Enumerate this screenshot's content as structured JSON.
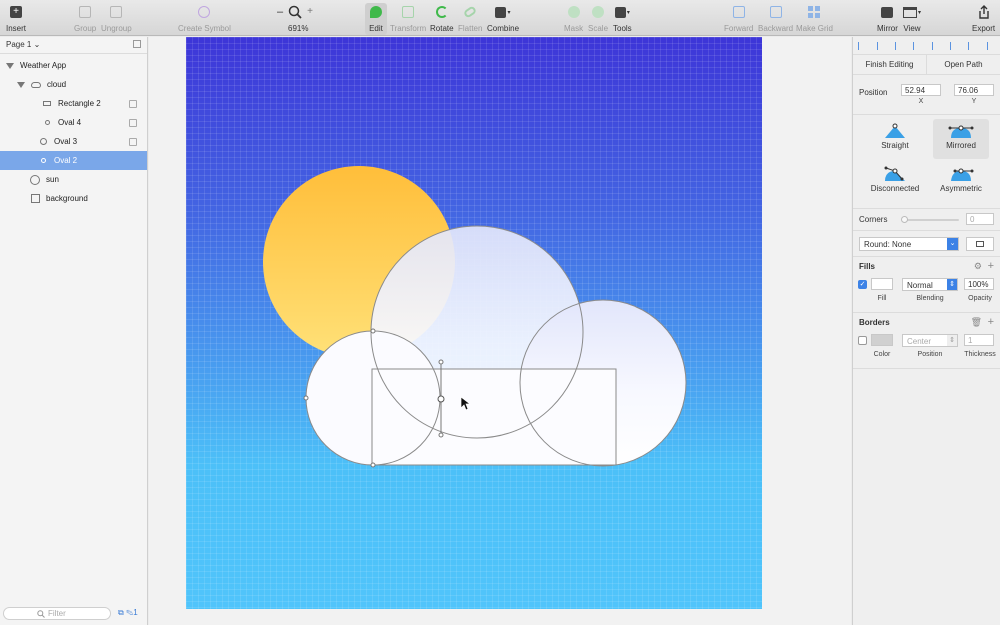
{
  "toolbar": {
    "insert": "Insert",
    "group": "Group",
    "ungroup": "Ungroup",
    "create_symbol": "Create Symbol",
    "zoom_minus": "–",
    "zoom_plus": "+",
    "zoom_level": "691%",
    "edit": "Edit",
    "transform": "Transform",
    "rotate": "Rotate",
    "flatten": "Flatten",
    "combine": "Combine",
    "mask": "Mask",
    "scale": "Scale",
    "tools": "Tools",
    "forward": "Forward",
    "backward": "Backward",
    "make_grid": "Make Grid",
    "mirror": "Mirror",
    "view": "View",
    "export": "Export"
  },
  "sidebar": {
    "page": "Page 1 ⌄",
    "layers": [
      {
        "label": "Weather App",
        "icon": "disclosure-triangle"
      },
      {
        "label": "cloud",
        "icon": "cloud-group-icon"
      },
      {
        "label": "Rectangle 2",
        "icon": "rectangle-icon"
      },
      {
        "label": "Oval 4",
        "icon": "oval-icon"
      },
      {
        "label": "Oval 3",
        "icon": "oval-icon"
      },
      {
        "label": "Oval 2",
        "icon": "oval-icon"
      },
      {
        "label": "sun",
        "icon": "oval-icon"
      },
      {
        "label": "background",
        "icon": "rectangle-icon"
      }
    ],
    "filter_placeholder": "Filter",
    "filter_badge": "1"
  },
  "inspector": {
    "finish_editing": "Finish Editing",
    "open_path": "Open Path",
    "position_label": "Position",
    "x_value": "52.94",
    "y_value": "76.06",
    "x_caption": "X",
    "y_caption": "Y",
    "modes": [
      "Straight",
      "Mirrored",
      "Disconnected",
      "Asymmetric"
    ],
    "corners_label": "Corners",
    "corners_value": "0",
    "round_value": "Round: None",
    "fills_title": "Fills",
    "fill_blending": "Normal",
    "fill_opacity": "100%",
    "fill_caption": "Fill",
    "blending_caption": "Blending",
    "opacity_caption": "Opacity",
    "borders_title": "Borders",
    "border_position": "Center",
    "border_thickness": "1",
    "color_caption": "Color",
    "position_caption": "Position",
    "thickness_caption": "Thickness"
  },
  "colors": {
    "accent": "#3c82e6",
    "selection": "#7aa7e9",
    "sun_top": "#ffbe3a",
    "sun_bottom": "#ffe178",
    "sky_top": "#3d35d8",
    "sky_bottom": "#50c4fb"
  }
}
